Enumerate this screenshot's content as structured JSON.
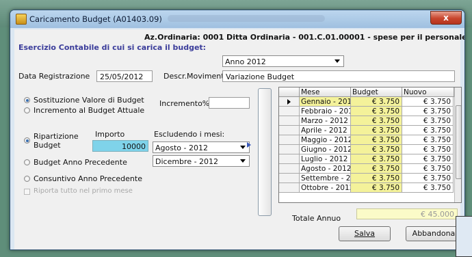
{
  "window": {
    "title": "Caricamento Budget (A01403.09)",
    "close_label": "x"
  },
  "header": {
    "ordinaria": "Az.Ordinaria: 0001 Ditta Ordinaria - 001.C.01.00001 - spese  per il personale"
  },
  "esercizio": {
    "label": "Esercizio Contabile di cui si carica il budget:",
    "value": "Anno 2012"
  },
  "registrazione": {
    "date_label": "Data Registrazione",
    "date_value": "25/05/2012",
    "desc_label": "Descr.Movimento",
    "desc_value": "Variazione Budget"
  },
  "options": {
    "sostituzione": "Sostituzione Valore di Budget",
    "incremento": "Incremento al Budget Attuale",
    "incremento_pct_label": "Incremento%",
    "incremento_pct_value": "",
    "ripartizione_line1": "Ripartizione",
    "ripartizione_line2": "Budget",
    "importo_label": "Importo",
    "importo_value": "10000",
    "escludendo_label": "Escludendo i mesi:",
    "escludi_1": "Agosto - 2012",
    "escludi_2": "Dicembre - 2012",
    "budget_anno_prec": "Budget Anno Precedente",
    "consuntivo_anno_prec": "Consuntivo Anno Precedente",
    "riporta": "Riporta tutto nel primo mese"
  },
  "grid": {
    "columns": [
      "Mese",
      "Budget",
      "Nuovo"
    ],
    "rows": [
      {
        "mese": "Gennaio - 201.",
        "budget": "€ 3.750",
        "nuovo": "€ 3.750"
      },
      {
        "mese": "Febbraio - 201.",
        "budget": "€ 3.750",
        "nuovo": "€ 3.750"
      },
      {
        "mese": "Marzo - 2012",
        "budget": "€ 3.750",
        "nuovo": "€ 3.750"
      },
      {
        "mese": "Aprile - 2012",
        "budget": "€ 3.750",
        "nuovo": "€ 3.750"
      },
      {
        "mese": "Maggio - 2012",
        "budget": "€ 3.750",
        "nuovo": "€ 3.750"
      },
      {
        "mese": "Giugno - 2012",
        "budget": "€ 3.750",
        "nuovo": "€ 3.750"
      },
      {
        "mese": "Luglio - 2012",
        "budget": "€ 3.750",
        "nuovo": "€ 3.750"
      },
      {
        "mese": "Agosto - 2012",
        "budget": "€ 3.750",
        "nuovo": "€ 3.750"
      },
      {
        "mese": "Settembre - 20",
        "budget": "€ 3.750",
        "nuovo": "€ 3.750"
      },
      {
        "mese": "Ottobre - 2012",
        "budget": "€ 3.750",
        "nuovo": "€ 3.750"
      }
    ]
  },
  "totale": {
    "label": "Totale Annuo",
    "value": "€ 45.000"
  },
  "buttons": {
    "salva": "Salva",
    "abbandona": "Abbandona"
  }
}
